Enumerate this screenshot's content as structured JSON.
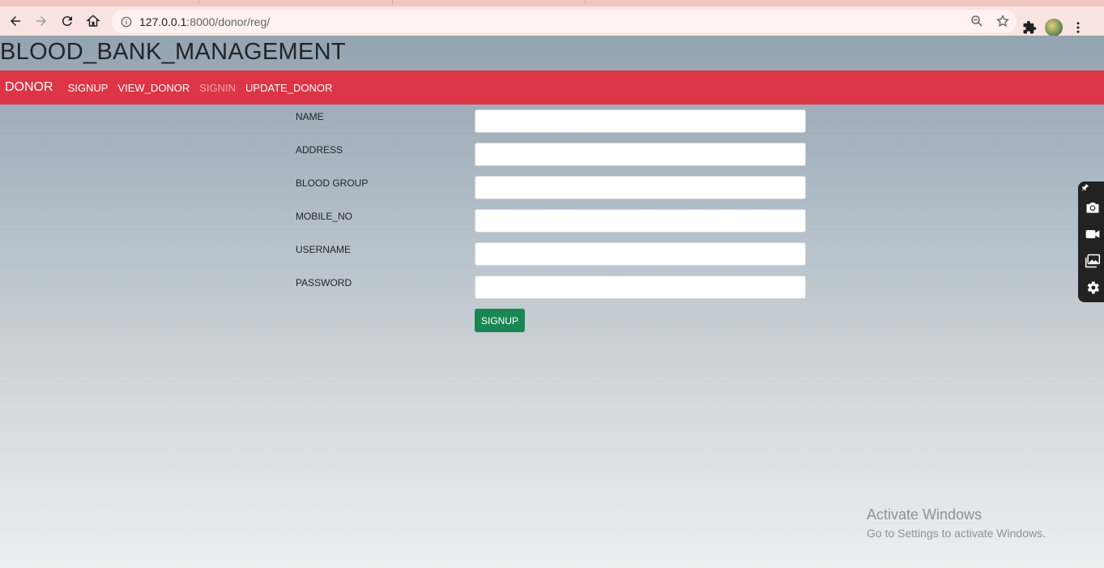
{
  "browser": {
    "url_host": "127.0.0.1",
    "url_path": ":8000/donor/reg/",
    "icons": [
      "back-icon",
      "forward-icon",
      "reload-icon",
      "home-icon",
      "info-icon",
      "zoom-icon",
      "star-icon",
      "extensions-icon",
      "avatar",
      "menu-icon"
    ]
  },
  "site": {
    "title": "BLOOD_BANK_MANAGEMENT"
  },
  "navbar": {
    "brand": "DONOR",
    "links": [
      "SIGNUP",
      "VIEW_DONOR",
      "SIGNIN",
      "UPDATE_DONOR"
    ],
    "color": "#dc3545"
  },
  "form": {
    "fields": [
      {
        "label": "NAME",
        "value": ""
      },
      {
        "label": "ADDRESS",
        "value": ""
      },
      {
        "label": "BLOOD GROUP",
        "value": ""
      },
      {
        "label": "MOBILE_NO",
        "value": ""
      },
      {
        "label": "USERNAME",
        "value": ""
      },
      {
        "label": "PASSWORD",
        "value": ""
      }
    ],
    "submit_label": "SIGNUP",
    "submit_color": "#198754"
  },
  "watermark": {
    "line1": "Activate Windows",
    "line2": "Go to Settings to activate Windows."
  },
  "side_widget": {
    "icons": [
      "pin-icon",
      "camera-icon",
      "video-icon",
      "gallery-icon",
      "settings-icon"
    ]
  }
}
